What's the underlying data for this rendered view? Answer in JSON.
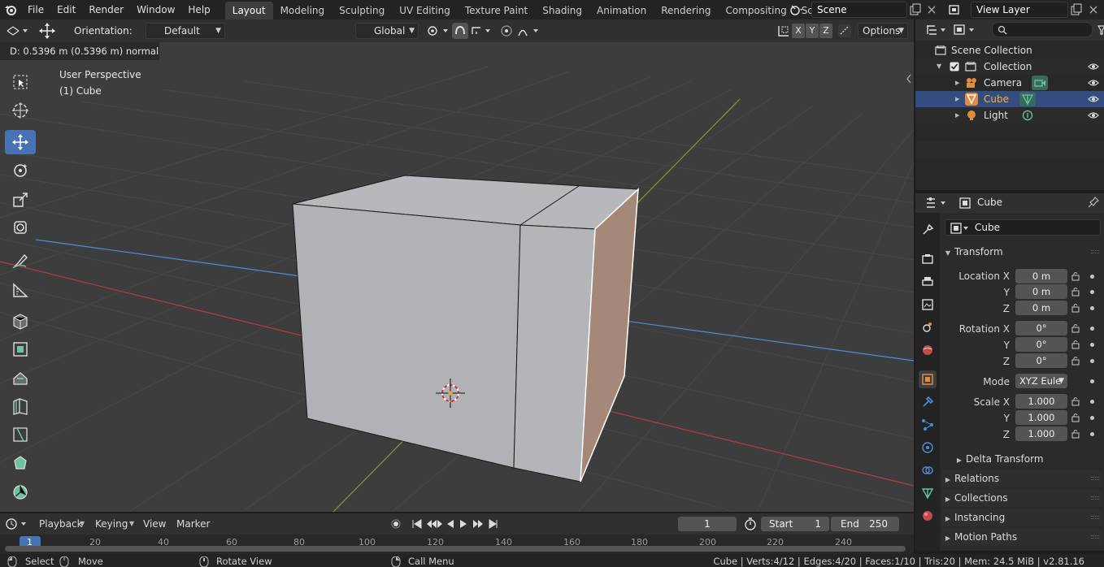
{
  "menubar": {
    "items": [
      "File",
      "Edit",
      "Render",
      "Window",
      "Help"
    ],
    "workspaces": [
      "Layout",
      "Modeling",
      "Sculpting",
      "UV Editing",
      "Texture Paint",
      "Shading",
      "Animation",
      "Rendering",
      "Compositing",
      "Scripting"
    ],
    "active_workspace": "Layout",
    "scene": "Scene",
    "view_layer": "View Layer"
  },
  "viewport_header": {
    "orientation_label": "Orientation:",
    "orientation_value": "Default",
    "transform_orientation": "Global",
    "axes": [
      "X",
      "Y",
      "Z"
    ],
    "options_label": "Options"
  },
  "viewport": {
    "operator_status": "D: 0.5396 m (0.5396 m) normal",
    "view_name": "User Perspective",
    "object_label": "(1) Cube"
  },
  "outliner": {
    "root": "Scene Collection",
    "collection": "Collection",
    "objects": [
      {
        "name": "Camera",
        "selected": false
      },
      {
        "name": "Cube",
        "selected": true
      },
      {
        "name": "Light",
        "selected": false
      }
    ]
  },
  "properties": {
    "context_name": "Cube",
    "object_name": "Cube",
    "transform_panel": "Transform",
    "location_label": "Location X",
    "location": [
      "0 m",
      "0 m",
      "0 m"
    ],
    "rotation_label": "Rotation X",
    "rotation": [
      "0°",
      "0°",
      "0°"
    ],
    "mode_label": "Mode",
    "mode_value": "XYZ Eule",
    "scale_label": "Scale X",
    "scale": [
      "1.000",
      "1.000",
      "1.000"
    ],
    "y_label": "Y",
    "z_label": "Z",
    "delta_transform": "Delta Transform",
    "panels": [
      "Relations",
      "Collections",
      "Instancing",
      "Motion Paths"
    ]
  },
  "timeline": {
    "menus": [
      "Playback",
      "Keying",
      "View",
      "Marker"
    ],
    "current_frame": "1",
    "start_label": "Start",
    "start_value": "1",
    "end_label": "End",
    "end_value": "250",
    "ruler_ticks": [
      "1",
      "20",
      "40",
      "60",
      "80",
      "100",
      "120",
      "140",
      "160",
      "180",
      "200",
      "220",
      "240"
    ]
  },
  "statusbar": {
    "select": "Select",
    "move": "Move",
    "rotate_view": "Rotate View",
    "call_menu": "Call Menu",
    "stats": "Cube | Verts:4/12 | Edges:4/20 | Faces:1/10 | Tris:20 | Mem: 24.5 MiB | v2.81.16"
  },
  "colors": {
    "accent": "#4772b3",
    "selected_row": "#334d80",
    "active_object_text": "#ffaf29",
    "x_axis": "#b83b3b",
    "y_axis": "#7e9e2d",
    "z_axis": "#4a8fd6",
    "face_highlight": "#a58878"
  }
}
